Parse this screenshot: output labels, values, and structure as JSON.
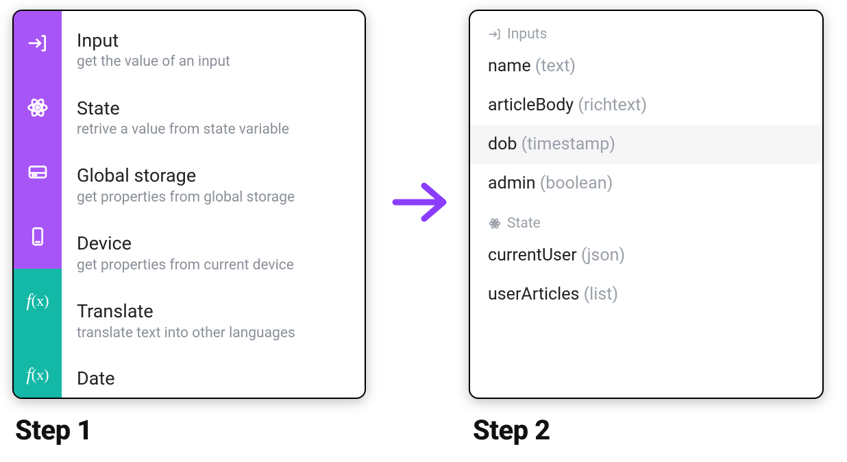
{
  "colors": {
    "purple": "#a855f7",
    "teal": "#14b8a6",
    "muted": "#8a8f98",
    "arrow": "#8b3dff"
  },
  "left_panel": {
    "items": [
      {
        "title": "Input",
        "desc": "get the value of an input",
        "icon": "input-icon",
        "rail": "purple"
      },
      {
        "title": "State",
        "desc": "retrive a value from state variable",
        "icon": "atom-icon",
        "rail": "purple"
      },
      {
        "title": "Global storage",
        "desc": "get properties from global storage",
        "icon": "storage-icon",
        "rail": "purple"
      },
      {
        "title": "Device",
        "desc": "get properties from current device",
        "icon": "device-icon",
        "rail": "purple"
      },
      {
        "title": "Translate",
        "desc": "translate text into other languages",
        "icon": "function-icon",
        "rail": "teal"
      },
      {
        "title": "Date",
        "desc": "",
        "icon": "function-icon",
        "rail": "teal"
      }
    ]
  },
  "right_panel": {
    "groups": [
      {
        "label": "Inputs",
        "icon": "input-icon",
        "vars": [
          {
            "name": "name",
            "type": "text",
            "highlight": false
          },
          {
            "name": "articleBody",
            "type": "richtext",
            "highlight": false
          },
          {
            "name": "dob",
            "type": "timestamp",
            "highlight": true
          },
          {
            "name": "admin",
            "type": "boolean",
            "highlight": false
          }
        ]
      },
      {
        "label": "State",
        "icon": "atom-icon",
        "vars": [
          {
            "name": "currentUser",
            "type": "json",
            "highlight": false
          },
          {
            "name": "userArticles",
            "type": "list",
            "highlight": false
          }
        ]
      }
    ]
  },
  "labels": {
    "step1": "Step 1",
    "step2": "Step 2"
  }
}
